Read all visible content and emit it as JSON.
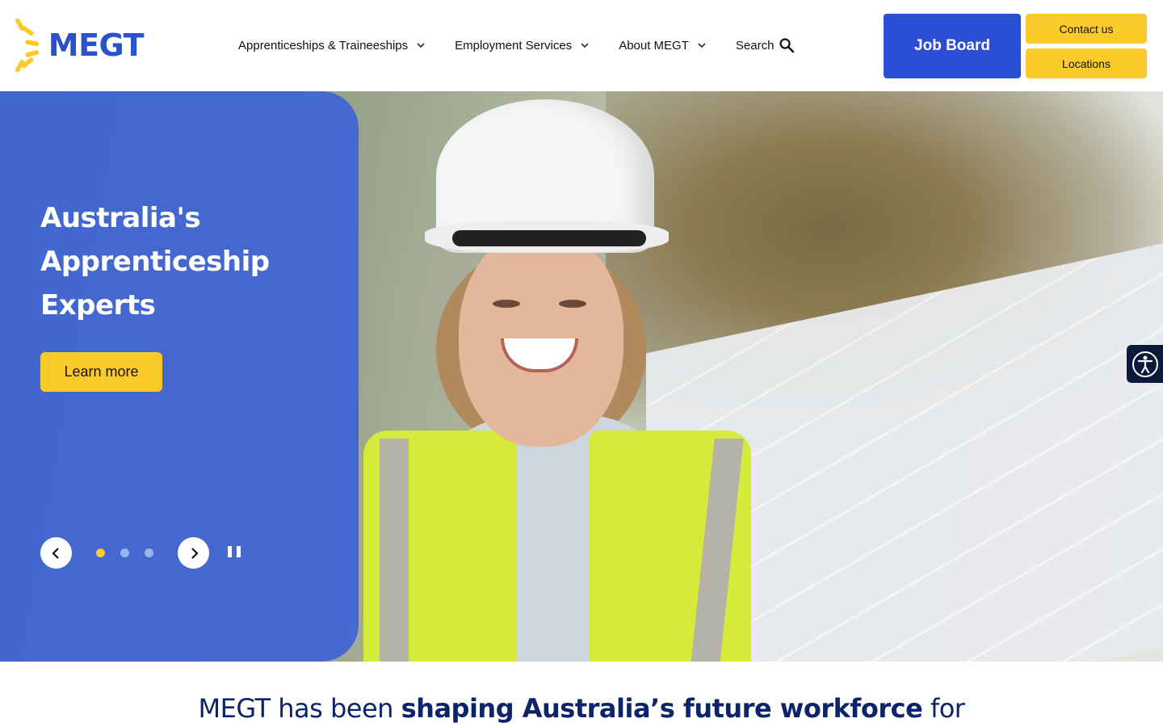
{
  "brand": {
    "name": "MEGT"
  },
  "nav": {
    "items": [
      {
        "label": "Apprenticeships & Traineeships"
      },
      {
        "label": "Employment Services"
      },
      {
        "label": "About MEGT"
      }
    ],
    "search_label": "Search"
  },
  "header_buttons": {
    "job_board": "Job Board",
    "contact": "Contact us",
    "locations": "Locations"
  },
  "hero": {
    "title_lines": [
      "Australia's",
      "Apprenticeship",
      "Experts"
    ],
    "cta_label": "Learn more",
    "slides": 3,
    "active_slide": 1
  },
  "tagline": {
    "prefix": "MEGT has been",
    "emphasis": "shaping Australia’s future workforce",
    "suffix": "for"
  },
  "colors": {
    "brand_blue": "#2a4fd6",
    "accent_yellow": "#fbcb2c",
    "navy": "#0d2468"
  }
}
